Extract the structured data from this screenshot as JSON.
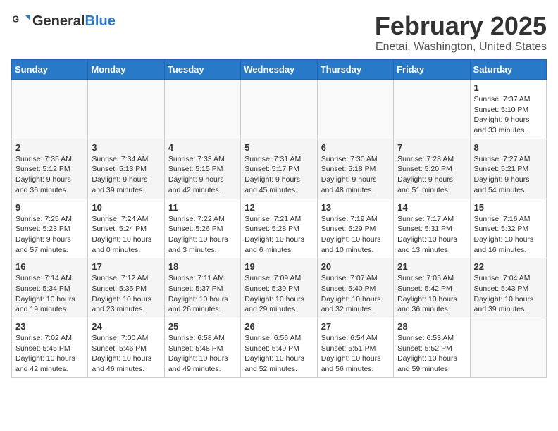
{
  "header": {
    "logo_general": "General",
    "logo_blue": "Blue",
    "month_title": "February 2025",
    "location": "Enetai, Washington, United States"
  },
  "calendar": {
    "days_of_week": [
      "Sunday",
      "Monday",
      "Tuesday",
      "Wednesday",
      "Thursday",
      "Friday",
      "Saturday"
    ],
    "weeks": [
      [
        {
          "day": "",
          "info": ""
        },
        {
          "day": "",
          "info": ""
        },
        {
          "day": "",
          "info": ""
        },
        {
          "day": "",
          "info": ""
        },
        {
          "day": "",
          "info": ""
        },
        {
          "day": "",
          "info": ""
        },
        {
          "day": "1",
          "info": "Sunrise: 7:37 AM\nSunset: 5:10 PM\nDaylight: 9 hours and 33 minutes."
        }
      ],
      [
        {
          "day": "2",
          "info": "Sunrise: 7:35 AM\nSunset: 5:12 PM\nDaylight: 9 hours and 36 minutes."
        },
        {
          "day": "3",
          "info": "Sunrise: 7:34 AM\nSunset: 5:13 PM\nDaylight: 9 hours and 39 minutes."
        },
        {
          "day": "4",
          "info": "Sunrise: 7:33 AM\nSunset: 5:15 PM\nDaylight: 9 hours and 42 minutes."
        },
        {
          "day": "5",
          "info": "Sunrise: 7:31 AM\nSunset: 5:17 PM\nDaylight: 9 hours and 45 minutes."
        },
        {
          "day": "6",
          "info": "Sunrise: 7:30 AM\nSunset: 5:18 PM\nDaylight: 9 hours and 48 minutes."
        },
        {
          "day": "7",
          "info": "Sunrise: 7:28 AM\nSunset: 5:20 PM\nDaylight: 9 hours and 51 minutes."
        },
        {
          "day": "8",
          "info": "Sunrise: 7:27 AM\nSunset: 5:21 PM\nDaylight: 9 hours and 54 minutes."
        }
      ],
      [
        {
          "day": "9",
          "info": "Sunrise: 7:25 AM\nSunset: 5:23 PM\nDaylight: 9 hours and 57 minutes."
        },
        {
          "day": "10",
          "info": "Sunrise: 7:24 AM\nSunset: 5:24 PM\nDaylight: 10 hours and 0 minutes."
        },
        {
          "day": "11",
          "info": "Sunrise: 7:22 AM\nSunset: 5:26 PM\nDaylight: 10 hours and 3 minutes."
        },
        {
          "day": "12",
          "info": "Sunrise: 7:21 AM\nSunset: 5:28 PM\nDaylight: 10 hours and 6 minutes."
        },
        {
          "day": "13",
          "info": "Sunrise: 7:19 AM\nSunset: 5:29 PM\nDaylight: 10 hours and 10 minutes."
        },
        {
          "day": "14",
          "info": "Sunrise: 7:17 AM\nSunset: 5:31 PM\nDaylight: 10 hours and 13 minutes."
        },
        {
          "day": "15",
          "info": "Sunrise: 7:16 AM\nSunset: 5:32 PM\nDaylight: 10 hours and 16 minutes."
        }
      ],
      [
        {
          "day": "16",
          "info": "Sunrise: 7:14 AM\nSunset: 5:34 PM\nDaylight: 10 hours and 19 minutes."
        },
        {
          "day": "17",
          "info": "Sunrise: 7:12 AM\nSunset: 5:35 PM\nDaylight: 10 hours and 23 minutes."
        },
        {
          "day": "18",
          "info": "Sunrise: 7:11 AM\nSunset: 5:37 PM\nDaylight: 10 hours and 26 minutes."
        },
        {
          "day": "19",
          "info": "Sunrise: 7:09 AM\nSunset: 5:39 PM\nDaylight: 10 hours and 29 minutes."
        },
        {
          "day": "20",
          "info": "Sunrise: 7:07 AM\nSunset: 5:40 PM\nDaylight: 10 hours and 32 minutes."
        },
        {
          "day": "21",
          "info": "Sunrise: 7:05 AM\nSunset: 5:42 PM\nDaylight: 10 hours and 36 minutes."
        },
        {
          "day": "22",
          "info": "Sunrise: 7:04 AM\nSunset: 5:43 PM\nDaylight: 10 hours and 39 minutes."
        }
      ],
      [
        {
          "day": "23",
          "info": "Sunrise: 7:02 AM\nSunset: 5:45 PM\nDaylight: 10 hours and 42 minutes."
        },
        {
          "day": "24",
          "info": "Sunrise: 7:00 AM\nSunset: 5:46 PM\nDaylight: 10 hours and 46 minutes."
        },
        {
          "day": "25",
          "info": "Sunrise: 6:58 AM\nSunset: 5:48 PM\nDaylight: 10 hours and 49 minutes."
        },
        {
          "day": "26",
          "info": "Sunrise: 6:56 AM\nSunset: 5:49 PM\nDaylight: 10 hours and 52 minutes."
        },
        {
          "day": "27",
          "info": "Sunrise: 6:54 AM\nSunset: 5:51 PM\nDaylight: 10 hours and 56 minutes."
        },
        {
          "day": "28",
          "info": "Sunrise: 6:53 AM\nSunset: 5:52 PM\nDaylight: 10 hours and 59 minutes."
        },
        {
          "day": "",
          "info": ""
        }
      ]
    ]
  }
}
